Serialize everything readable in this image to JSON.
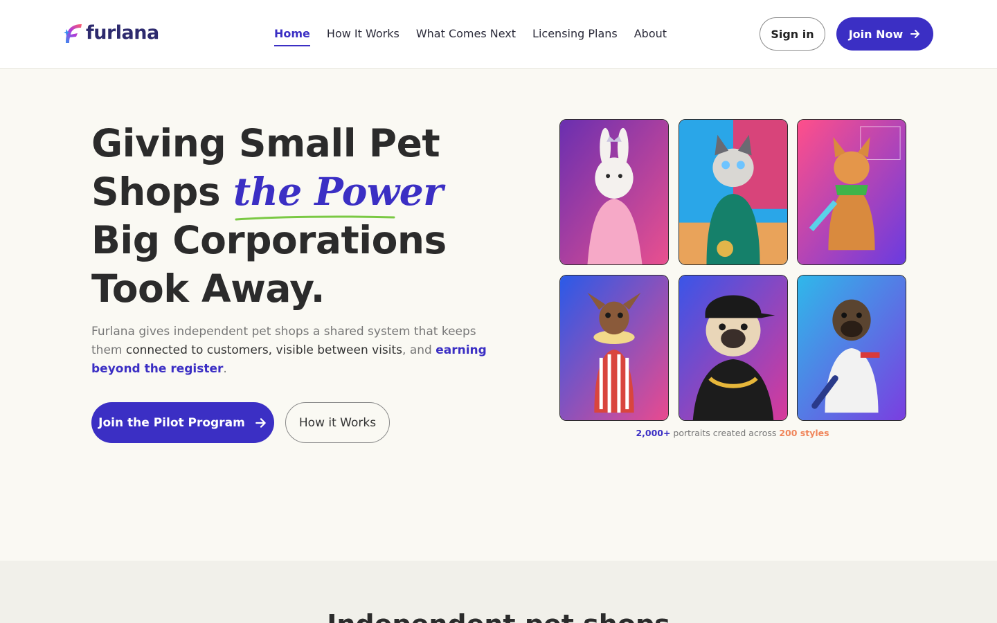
{
  "brand": {
    "name": "furlana",
    "accent": "#3b2fc4",
    "highlight": "#f0855a"
  },
  "nav": {
    "items": [
      "Home",
      "How It Works",
      "What Comes Next",
      "Licensing Plans",
      "About"
    ],
    "active": "Home"
  },
  "header": {
    "signin_label": "Sign in",
    "join_label": "Join Now"
  },
  "hero": {
    "title_lines": [
      "Giving Small Pet",
      "Shops",
      "the Power",
      "Big Corporations",
      "Took Away."
    ],
    "sub_part1": "Furlana gives independent pet shops a shared system that keeps them",
    "sub_part2": "connected to customers, visible between visits",
    "sub_part3": ", and ",
    "sub_part4": "earning beyond the register",
    "sub_part5": ".",
    "primary_cta": "Join the Pilot Program",
    "secondary_cta": "How it Works"
  },
  "gallery": {
    "portraits": [
      {
        "subject": "bunny-princess-portrait"
      },
      {
        "subject": "cat-tracksuit-portrait"
      },
      {
        "subject": "corgi-gamer-portrait"
      },
      {
        "subject": "chihuahua-popcorn-portrait"
      },
      {
        "subject": "pug-hiphop-portrait"
      },
      {
        "subject": "terrier-hoodie-portrait"
      }
    ],
    "caption_count": "2,000+",
    "caption_mid": " portraits created across ",
    "caption_styles": "200 styles"
  },
  "section2": {
    "title": "Independent pet shops"
  }
}
